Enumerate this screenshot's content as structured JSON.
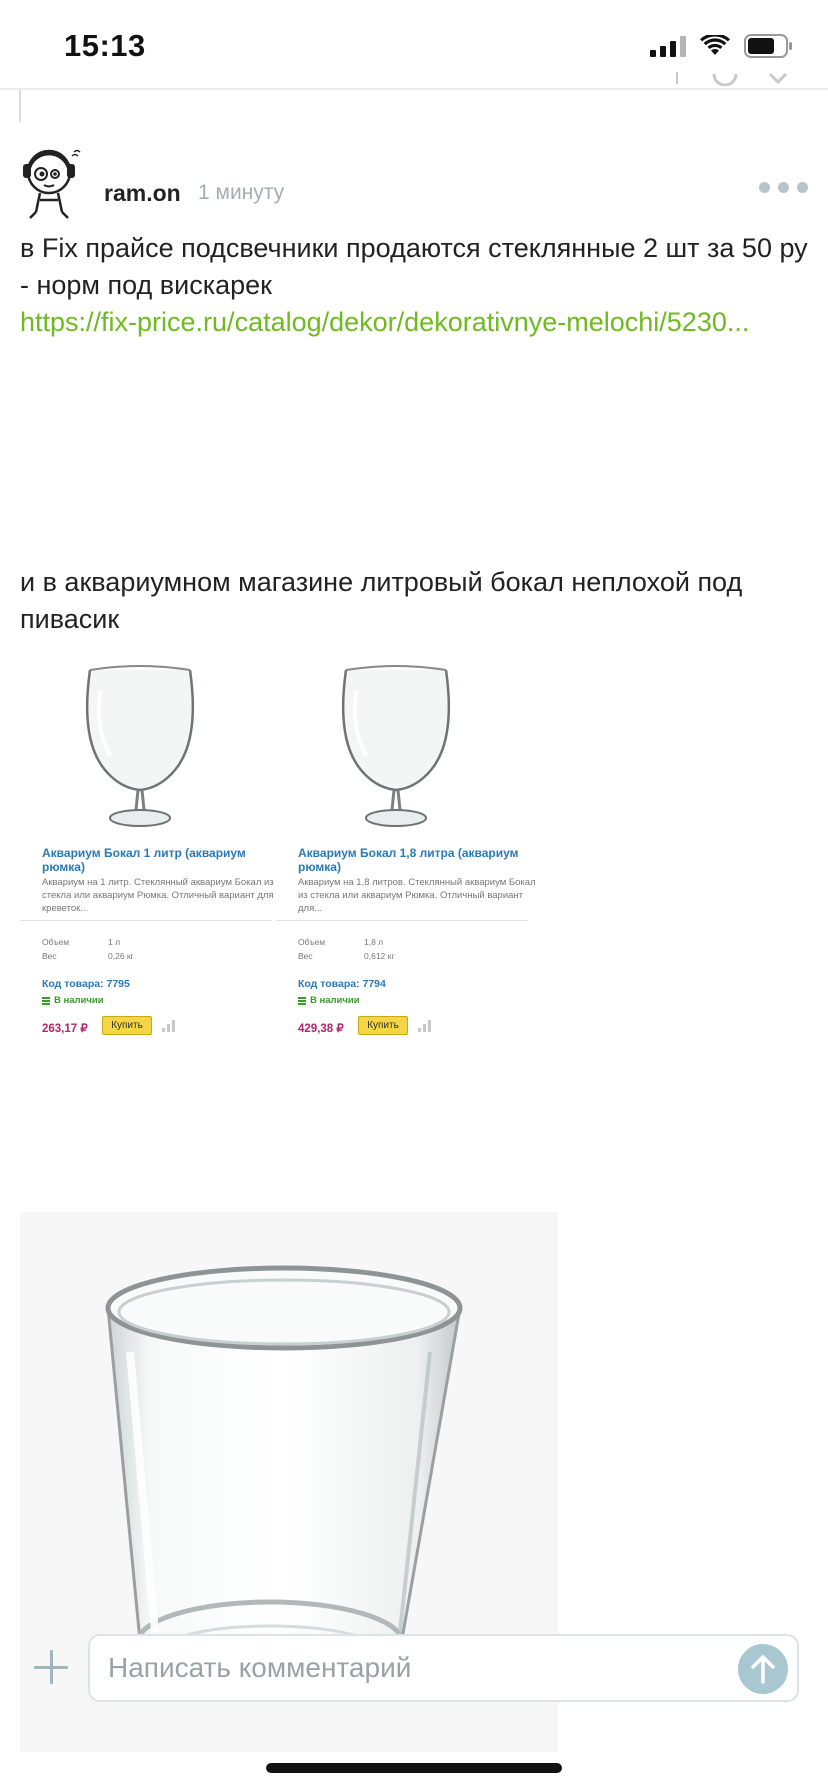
{
  "status_bar": {
    "time": "15:13"
  },
  "comment": {
    "author": "ram.on",
    "time_ago": "1 минуту",
    "text_1": "в Fix прайсе подсвечники продаются стеклянные 2 шт за 50 ру - норм под вискарек",
    "link": "https://fix-price.ru/catalog/dekor/dekorativnye-melochi/5230...",
    "text_2": "и в аквариумном магазине литровый бокал неплохой под пивасик"
  },
  "products": [
    {
      "title": "Аквариум Бокал 1 литр (аквариум рюмка)",
      "description": "Аквариум на 1 литр. Стеклянный аквариум Бокал из стекла или аквариум Рюмка. Отличный вариант для креветок...",
      "spec_volume_label": "Объем",
      "spec_volume_value": "1 л",
      "spec_weight_label": "Вес",
      "spec_weight_value": "0,26 кг",
      "code": "Код товара: 7795",
      "stock": "В наличии",
      "price": "263,17 ₽",
      "buy_label": "Купить"
    },
    {
      "title": "Аквариум Бокал 1,8 литра (аквариум рюмка)",
      "description": "Аквариум на 1,8 литров. Стеклянный аквариум Бокал из стекла или аквариум Рюмка. Отличный вариант для...",
      "spec_volume_label": "Объем",
      "spec_volume_value": "1,8 л",
      "spec_weight_label": "Вес",
      "spec_weight_value": "0,612 кг",
      "code": "Код товара: 7794",
      "stock": "В наличии",
      "price": "429,38 ₽",
      "buy_label": "Купить"
    }
  ],
  "input_bar": {
    "placeholder": "Написать комментарий"
  },
  "colors": {
    "link": "#6fba1f",
    "muted": "#a6acb1",
    "send_button": "#a8c7d1"
  },
  "icons": [
    "signal-icon",
    "wifi-icon",
    "battery-icon",
    "more-icon",
    "plus-icon",
    "send-arrow-icon"
  ]
}
